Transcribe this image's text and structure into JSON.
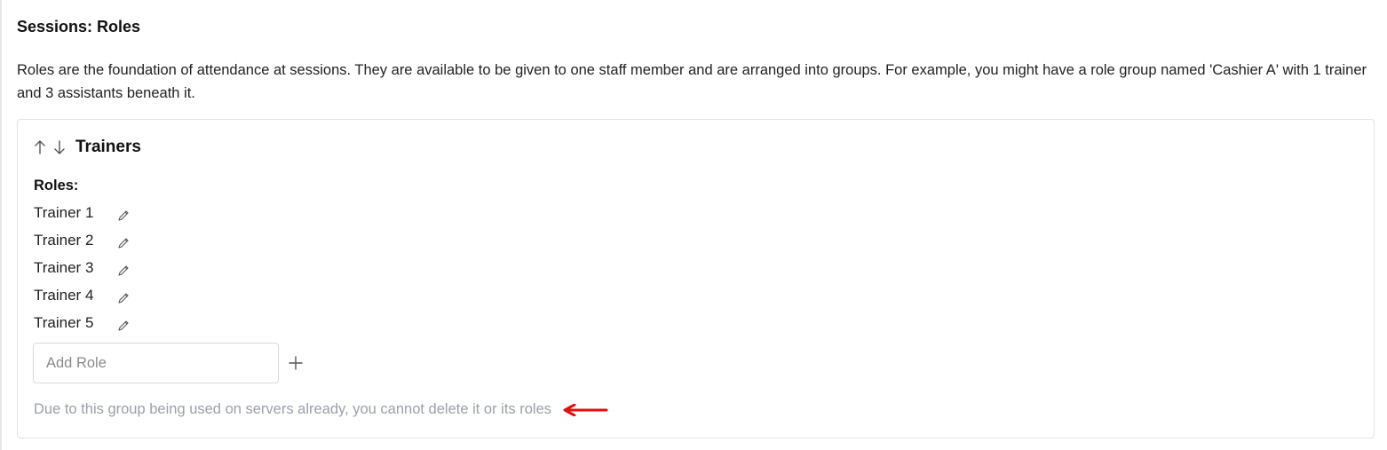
{
  "section": {
    "title": "Sessions: Roles",
    "description": "Roles are the foundation of attendance at sessions. They are available to be given to one staff member and are arranged into groups. For example, you might have a role group named 'Cashier A' with 1 trainer and 3 assistants beneath it."
  },
  "group": {
    "name": "Trainers",
    "roles_label": "Roles:",
    "roles": [
      {
        "label": "Trainer 1",
        "icon": "pencil-icon"
      },
      {
        "label": "Trainer 2",
        "icon": "pencil-icon"
      },
      {
        "label": "Trainer 3",
        "icon": "pencil-icon"
      },
      {
        "label": "Trainer 4",
        "icon": "pencil-icon"
      },
      {
        "label": "Trainer 5",
        "icon": "pencil-icon"
      }
    ],
    "add_role": {
      "placeholder": "Add Role",
      "value": ""
    },
    "note": "Due to this group being used on servers already, you cannot delete it or its roles"
  },
  "colors": {
    "annotation_arrow": "#e01010",
    "note_text": "#9aa0a8"
  }
}
